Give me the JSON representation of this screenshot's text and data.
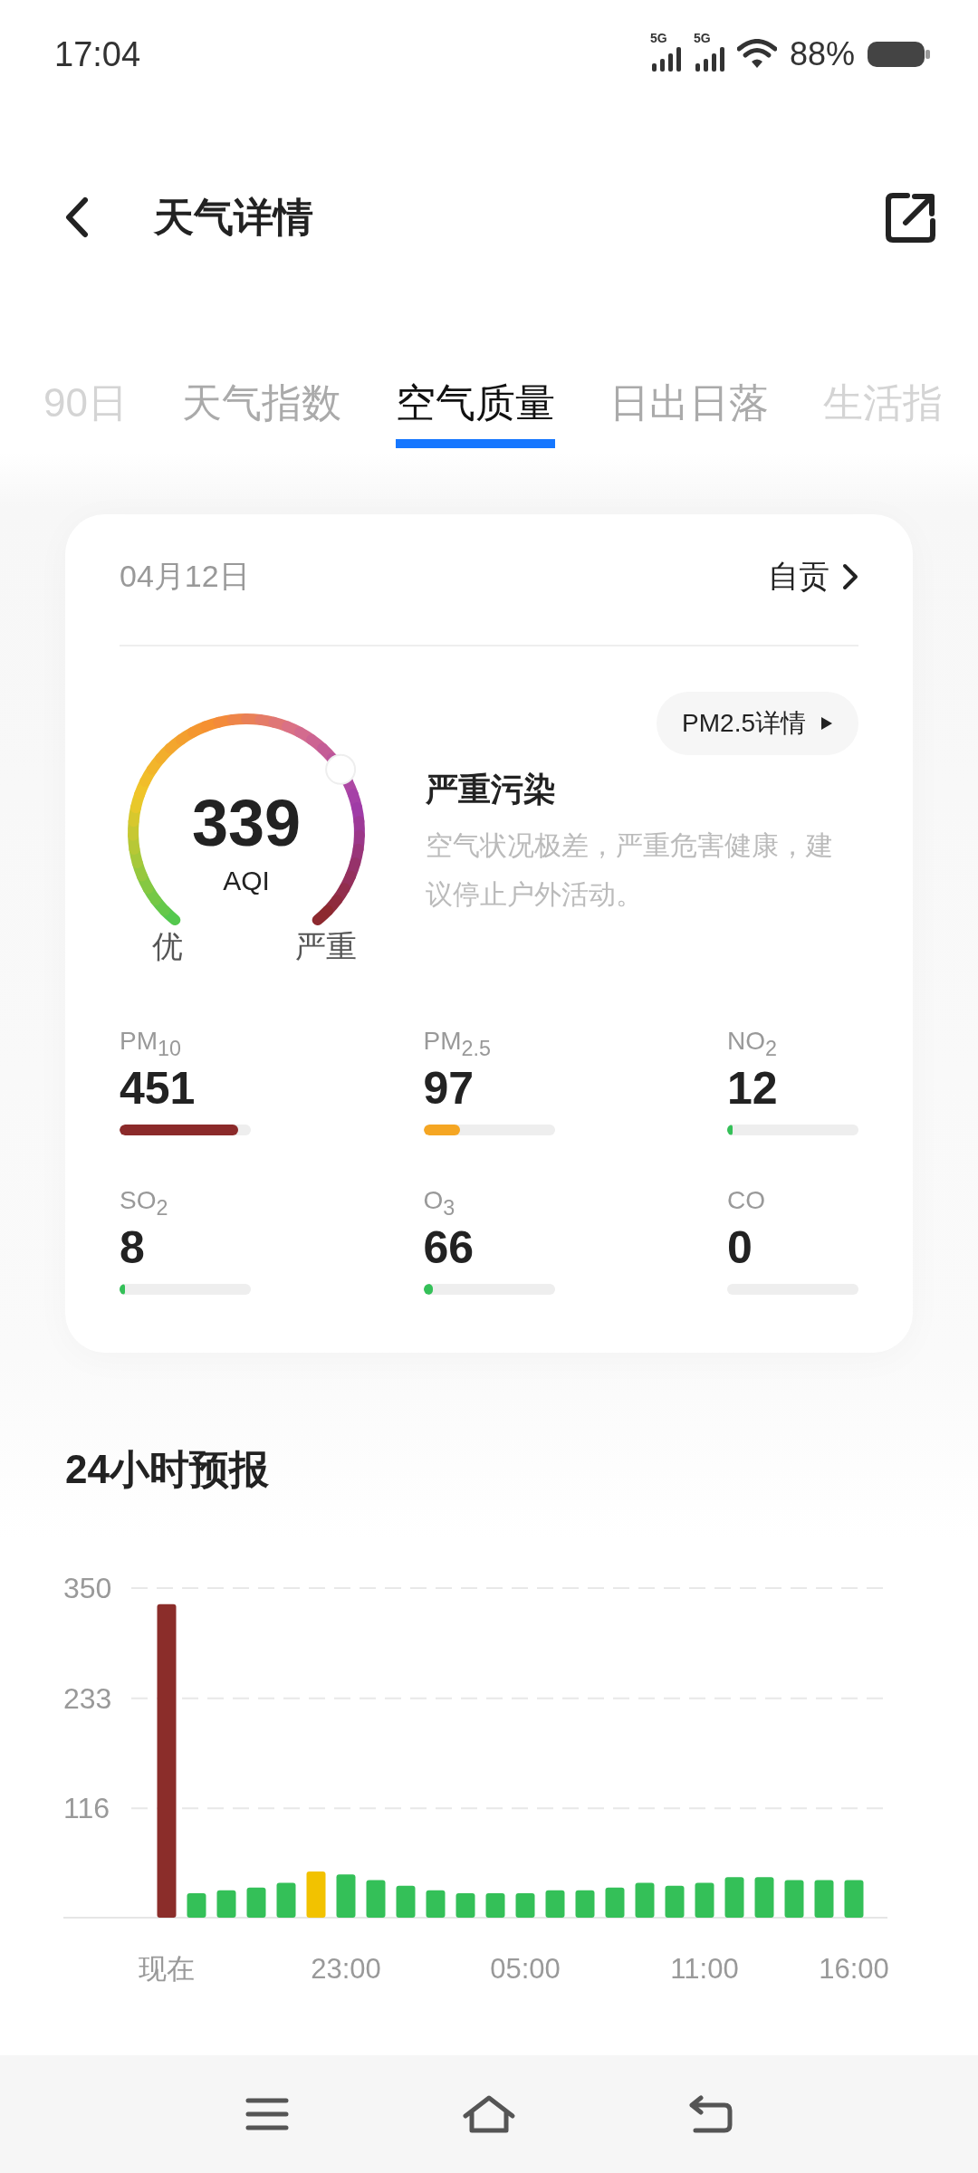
{
  "status_bar": {
    "time": "17:04",
    "signal_labels": [
      "5G",
      "5G"
    ],
    "battery": "88%"
  },
  "header": {
    "title": "天气详情"
  },
  "tabs": [
    {
      "label": "90日",
      "selected": false
    },
    {
      "label": "天气指数",
      "selected": false
    },
    {
      "label": "空气质量",
      "selected": true
    },
    {
      "label": "日出日落",
      "selected": false
    },
    {
      "label": "生活指",
      "selected": false
    }
  ],
  "aqi_card": {
    "date": "04月12日",
    "location": "自贡",
    "detail_button": "PM2.5详情",
    "gauge": {
      "value": "339",
      "unit": "AQI",
      "min_label": "优",
      "max_label": "严重"
    },
    "status": "严重污染",
    "advice": "空气状况极差，严重危害健康，建议停止户外活动。",
    "pollutants": [
      {
        "name": "PM$_{10}$",
        "value": "451",
        "level": 0.9,
        "color": "#8b2a2a"
      },
      {
        "name": "PM$_{2.5}$",
        "value": "97",
        "level": 0.28,
        "color": "#f5a623"
      },
      {
        "name": "NO$_{2}$",
        "value": "12",
        "level": 0.02,
        "color": "#34c058"
      },
      {
        "name": "SO$_{2}$",
        "value": "8",
        "level": 0.01,
        "color": "#34c058"
      },
      {
        "name": "O$_{3}$",
        "value": "66",
        "level": 0.07,
        "color": "#34c058"
      },
      {
        "name": "CO",
        "value": "0"
      }
    ]
  },
  "forecast": {
    "title": "24小时预报",
    "chart_data": {
      "type": "bar",
      "categories": [
        "现在",
        null,
        null,
        null,
        null,
        null,
        "23:00",
        null,
        null,
        null,
        null,
        null,
        "05:00",
        null,
        null,
        null,
        null,
        null,
        "11:00",
        null,
        null,
        null,
        null,
        "16:00"
      ],
      "ylim": [
        0,
        350
      ],
      "yticks": [
        116,
        233,
        350
      ],
      "series": [
        {
          "color": "#8b2d2a",
          "values": [
            333,
            null,
            null,
            null,
            null,
            null,
            null,
            null,
            null,
            null,
            null,
            null,
            null,
            null,
            null,
            null,
            null,
            null,
            null,
            null,
            null,
            null,
            null,
            null
          ]
        },
        {
          "color": "#f2c200",
          "values": [
            null,
            null,
            null,
            null,
            null,
            49,
            null,
            null,
            null,
            null,
            null,
            null,
            null,
            null,
            null,
            null,
            null,
            null,
            null,
            null,
            null,
            null,
            null,
            null
          ]
        },
        {
          "color": "#34c058",
          "values": [
            null,
            26,
            29,
            32,
            37,
            null,
            46,
            40,
            34,
            29,
            26,
            26,
            26,
            29,
            29,
            32,
            37,
            34,
            37,
            43,
            43,
            40,
            40,
            40
          ]
        }
      ]
    }
  }
}
